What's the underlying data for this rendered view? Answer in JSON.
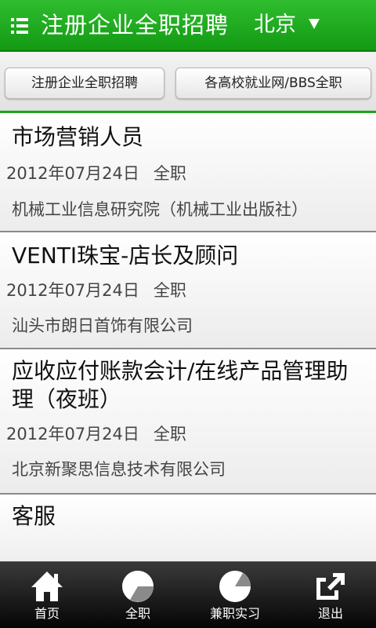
{
  "header": {
    "title": "注册企业全职招聘",
    "city": "北京"
  },
  "tabs": [
    {
      "label": "注册企业全职招聘"
    },
    {
      "label": "各高校就业网/BBS全职"
    }
  ],
  "jobs": [
    {
      "title": "市场营销人员",
      "date": "2012年07月24日",
      "type": "全职",
      "company": "机械工业信息研究院（机械工业出版社）"
    },
    {
      "title": "VENTI珠宝-店长及顾问",
      "date": "2012年07月24日",
      "type": "全职",
      "company": "汕头市朗日首饰有限公司"
    },
    {
      "title": "应收应付账款会计/在线产品管理助理（夜班）",
      "date": "2012年07月24日",
      "type": "全职",
      "company": "北京新聚思信息技术有限公司"
    },
    {
      "title": "客服"
    }
  ],
  "nav": [
    {
      "label": "首页",
      "icon": "home-icon"
    },
    {
      "label": "全职",
      "icon": "pie-icon"
    },
    {
      "label": "兼职实习",
      "icon": "pie-icon"
    },
    {
      "label": "退出",
      "icon": "exit-icon"
    }
  ],
  "colors": {
    "header_green": "#139a13",
    "accent_line": "#18a818",
    "nav_dark": "#050505"
  }
}
